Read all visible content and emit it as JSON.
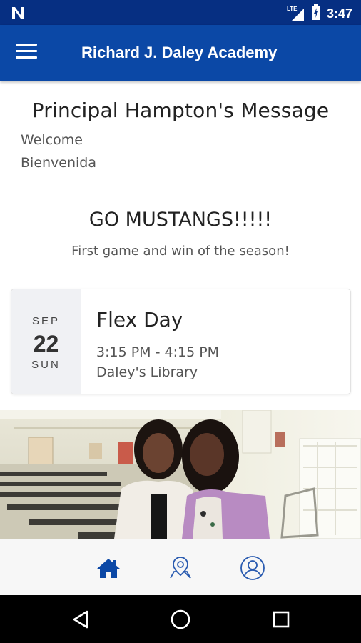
{
  "status_bar": {
    "notification_icon": "n-logo-icon",
    "network_label": "LTE",
    "time": "3:47"
  },
  "app_bar": {
    "title": "Richard J. Daley Academy",
    "menu_icon": "hamburger-menu-icon"
  },
  "principal_message": {
    "title": "Principal Hampton's Message",
    "lines": [
      "Welcome",
      "Bienvenida"
    ]
  },
  "announcement": {
    "title": "GO MUSTANGS!!!!!",
    "subtitle": "First game and win of the season!"
  },
  "event": {
    "month": "SEP",
    "day": "22",
    "weekday": "SUN",
    "name": "Flex Day",
    "time": "3:15 PM - 4:15 PM",
    "location": "Daley's Library"
  },
  "bottom_nav": {
    "items": [
      {
        "icon": "home-icon",
        "active": true
      },
      {
        "icon": "map-location-icon",
        "active": false
      },
      {
        "icon": "profile-icon",
        "active": false
      }
    ],
    "active_color": "#0b48a6",
    "inactive_color": "#2a5bb0"
  },
  "system_nav": {
    "items": [
      "back-icon",
      "home-circle-icon",
      "recents-icon"
    ]
  },
  "colors": {
    "status_bar": "#062f82",
    "app_bar": "#0b48a6",
    "date_panel": "#f0f1f4"
  }
}
